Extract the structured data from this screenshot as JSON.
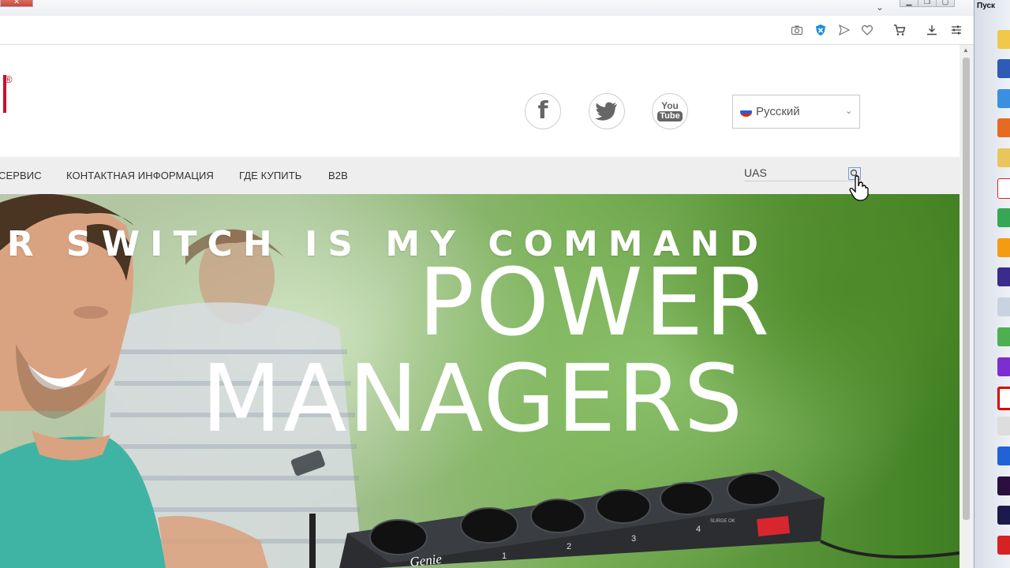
{
  "browser": {
    "toolbar_icons": [
      "camera-icon",
      "shield-icon",
      "send-icon",
      "heart-icon",
      "cart-icon",
      "download-icon",
      "settings-sliders-icon"
    ]
  },
  "header": {
    "logo_registered_mark": "®",
    "social": [
      {
        "name": "facebook",
        "glyph": "f"
      },
      {
        "name": "twitter",
        "glyph": "twitter-bird"
      },
      {
        "name": "youtube",
        "line1": "You",
        "line2": "Tube"
      }
    ],
    "language": {
      "label": "Русский",
      "caret": "⌄"
    }
  },
  "nav": {
    "items": [
      "СЕРВИС",
      "КОНТАКТНАЯ ИНФОРМАЦИЯ",
      "ГДЕ КУПИТЬ",
      "B2B"
    ],
    "search": {
      "value": "UAS"
    }
  },
  "hero": {
    "tagline": "UR SWITCH IS MY COMMAND",
    "title_line1": "POWER",
    "title_line2": "MANAGERS",
    "socket_numbers": [
      "1",
      "2",
      "3",
      "4"
    ],
    "brand_on_product": "Genie",
    "surge_label": "SURGE OK"
  },
  "taskbar": {
    "start_label": "Пуск",
    "apps": [
      "mail-icon",
      "word-icon",
      "ie-icon",
      "firefox-icon",
      "folder-icon",
      "yandex-icon",
      "chrome-icon",
      "media-player-icon",
      "video-editor-icon",
      "calculator-icon",
      "drive-icon",
      "play-icon",
      "opera-icon",
      "eye-icon",
      "audio-icon",
      "premiere-icon",
      "after-effects-icon",
      "app-icon"
    ]
  },
  "colors": {
    "brand_red": "#c8102e",
    "hero_green": "#4d8a28"
  }
}
